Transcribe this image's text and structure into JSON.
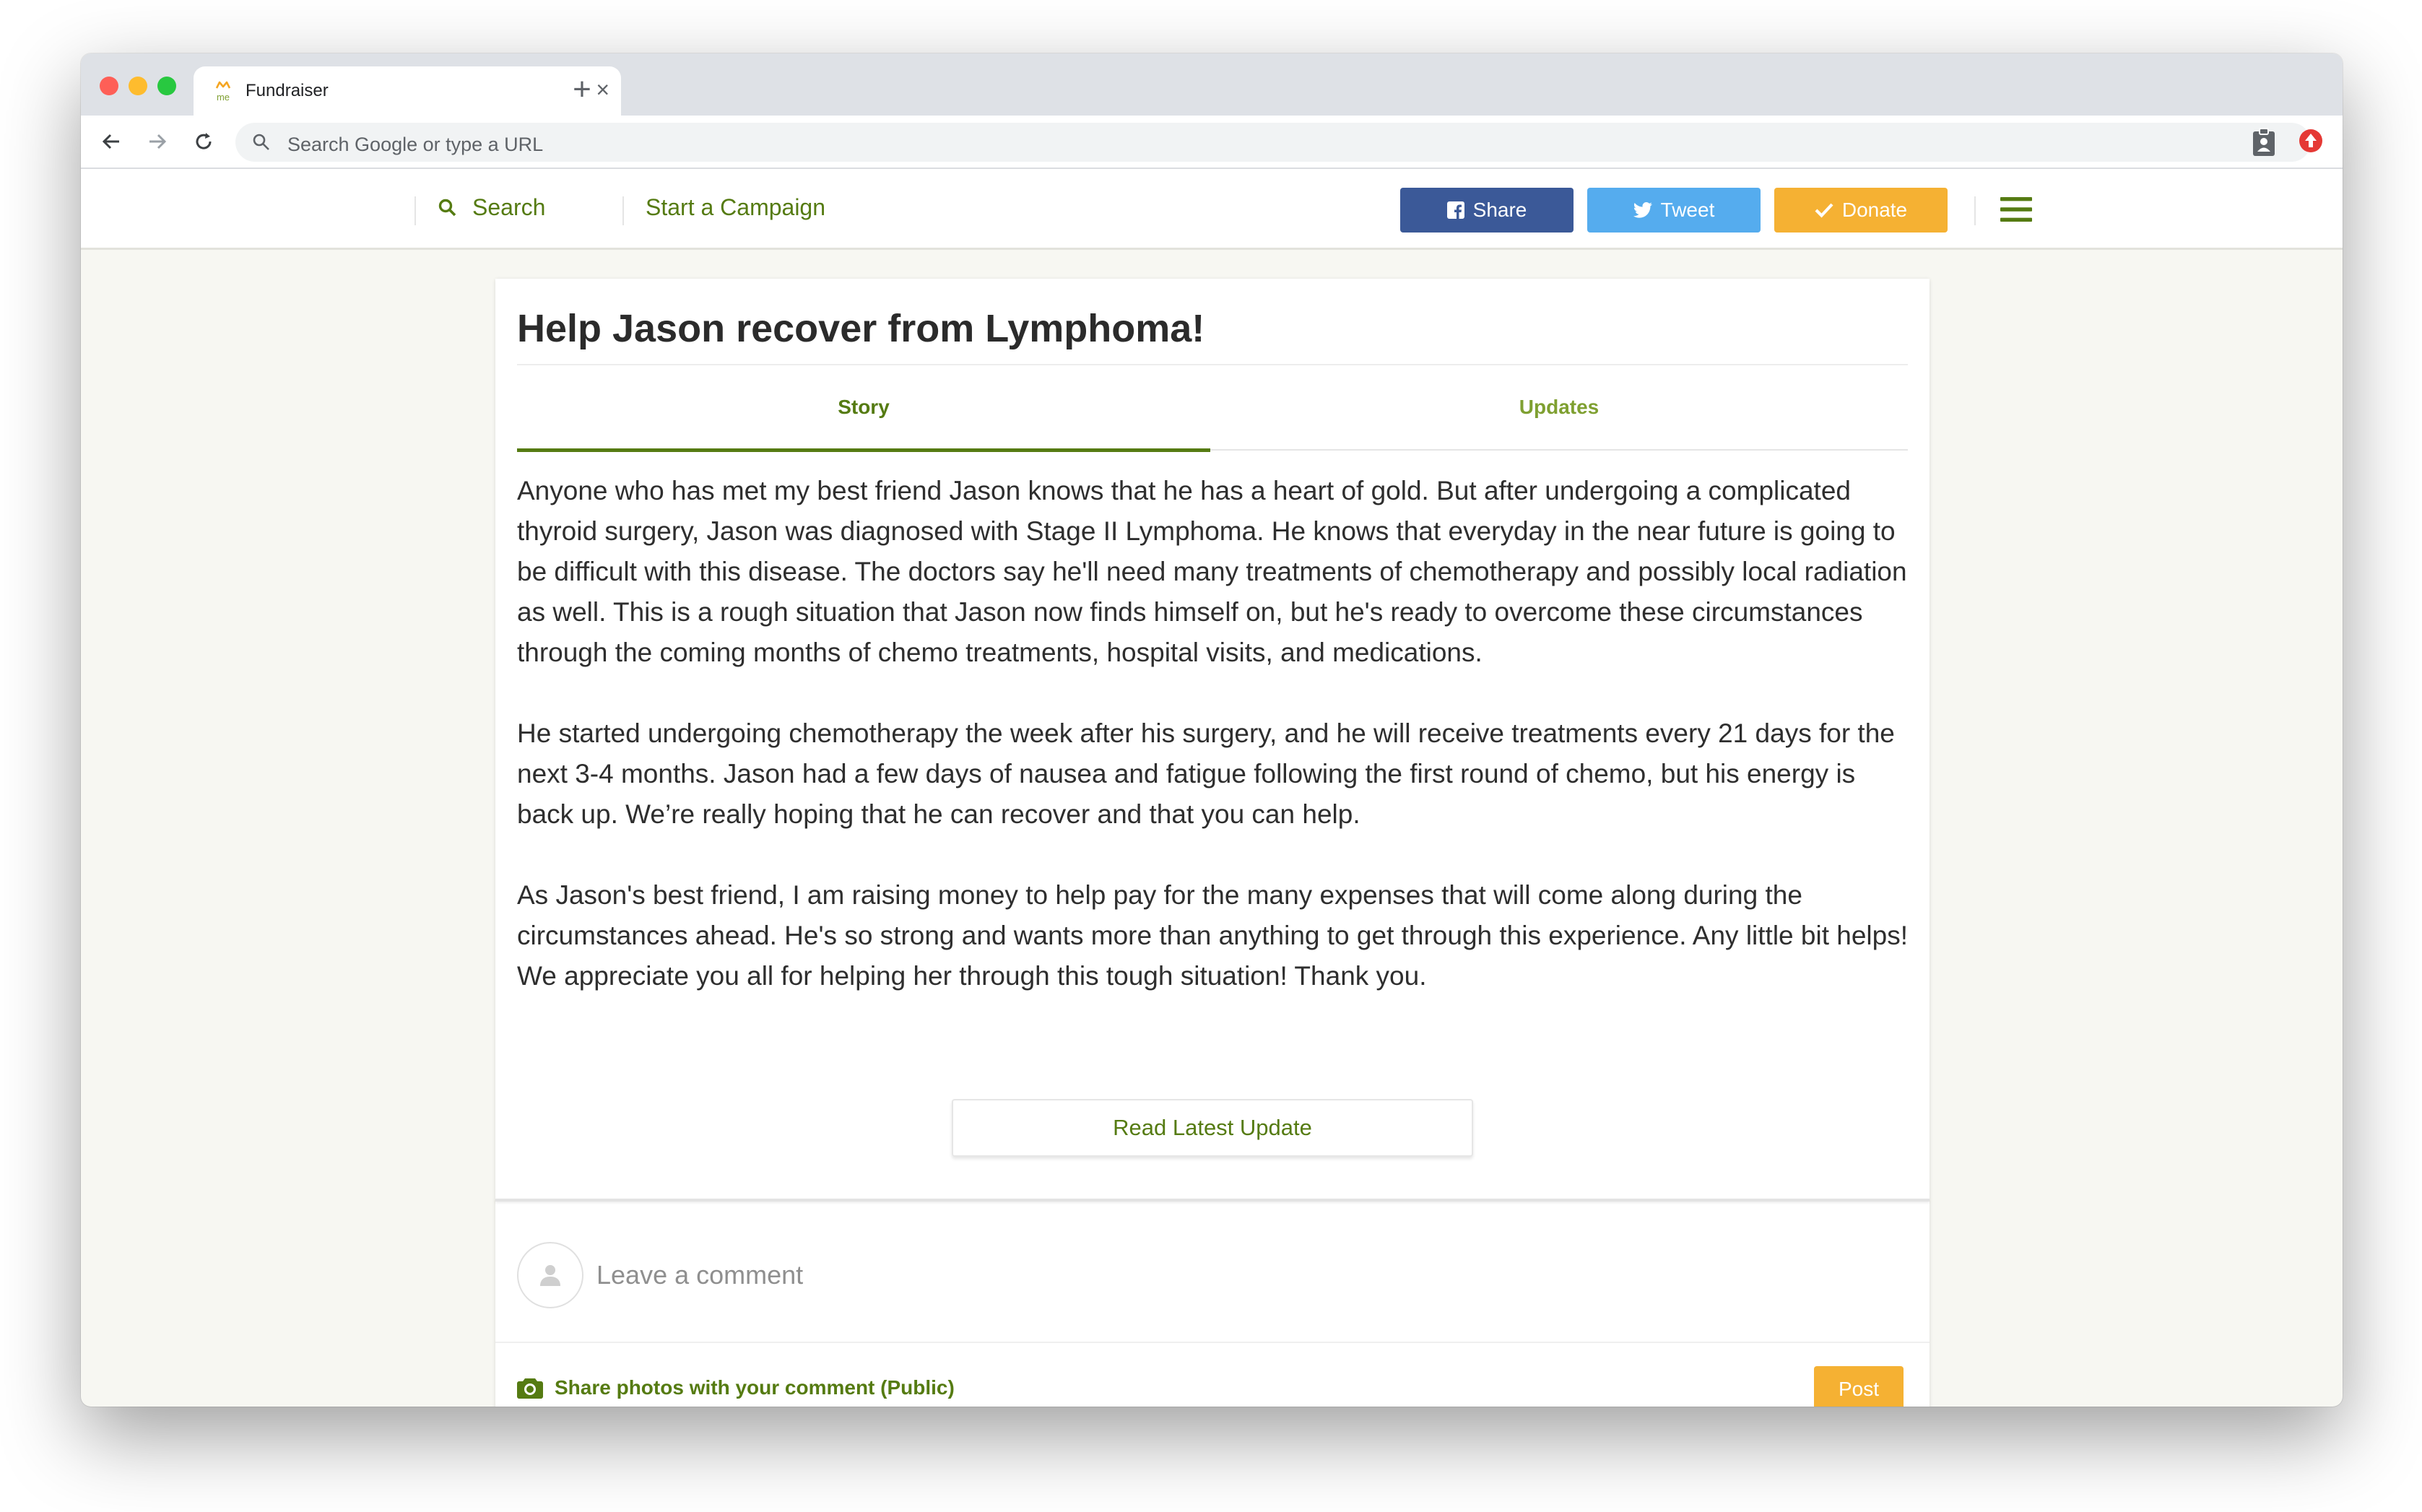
{
  "browser": {
    "tab_title": "Fundraiser",
    "favicon_text": "me",
    "address_placeholder": "Search Google or type a URL",
    "icons": [
      "back-arrow-icon",
      "forward-arrow-icon",
      "reload-icon",
      "search-icon",
      "clipboard-icon",
      "extension-icon"
    ]
  },
  "site_nav": {
    "search_label": "Search",
    "start_campaign_label": "Start a Campaign",
    "share_label": "Share",
    "tweet_label": "Tweet",
    "donate_label": "Donate"
  },
  "campaign": {
    "title": "Help Jason recover from Lymphoma!",
    "tabs": [
      {
        "label": "Story",
        "active": true
      },
      {
        "label": "Updates",
        "active": false
      }
    ],
    "story": [
      "Anyone who has met my best friend Jason knows that he has a heart of gold. But after undergoing a complicated thyroid surgery, Jason was diagnosed with Stage II Lymphoma. He knows that everyday in the near future is going to be difficult with this disease. The doctors say he'll need many treatments of chemotherapy and possibly local radiation as well. This is a rough situation that Jason now finds himself on, but he's ready to overcome these circumstances through the coming months of chemo treatments, hospital visits, and medications.",
      "He started undergoing chemotherapy the week after his surgery, and he will receive treatments every 21 days for the next 3-4 months. Jason had a few days of nausea and fatigue following the first round of chemo, but his energy is back up. We’re really hoping that he can recover and that you can help.",
      "As Jason's best friend, I am raising money to help pay for the many expenses that will come along during the circumstances ahead. He's so strong and wants more than anything to get through this experience. Any little bit helps! We appreciate you all for helping her through this tough situation! Thank you."
    ],
    "read_update_label": "Read Latest Update"
  },
  "comments": {
    "placeholder": "Leave a comment",
    "share_photos_label": "Share photos with your comment (Public)",
    "post_label": "Post"
  },
  "colors": {
    "brand_green": "#557b12",
    "facebook_blue": "#3b5998",
    "twitter_blue": "#55acee",
    "donate_orange": "#f5b133"
  }
}
